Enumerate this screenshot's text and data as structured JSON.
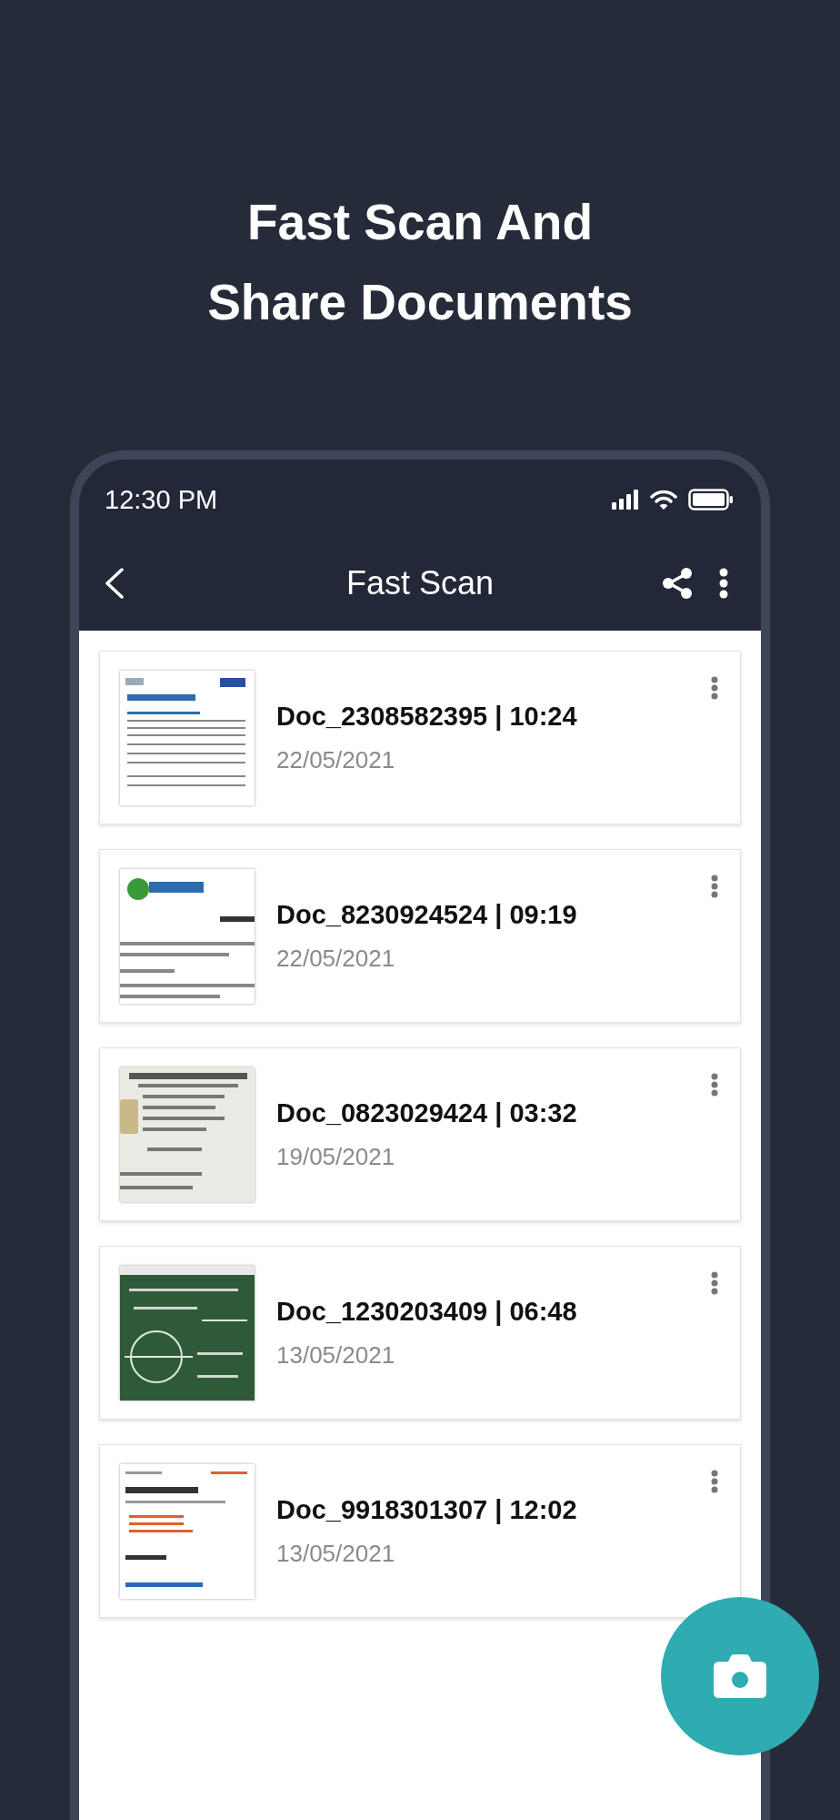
{
  "headline": [
    "Fast Scan And",
    "Share Documents"
  ],
  "status_bar": {
    "time": "12:30 PM"
  },
  "app_bar": {
    "title": "Fast Scan"
  },
  "documents": [
    {
      "name": "Doc_2308582395 | 10:24",
      "date": "22/05/2021"
    },
    {
      "name": "Doc_8230924524 | 09:19",
      "date": "22/05/2021"
    },
    {
      "name": "Doc_0823029424 | 03:32",
      "date": "19/05/2021"
    },
    {
      "name": "Doc_1230203409 | 06:48",
      "date": "13/05/2021"
    },
    {
      "name": "Doc_9918301307 | 12:02",
      "date": "13/05/2021"
    }
  ]
}
